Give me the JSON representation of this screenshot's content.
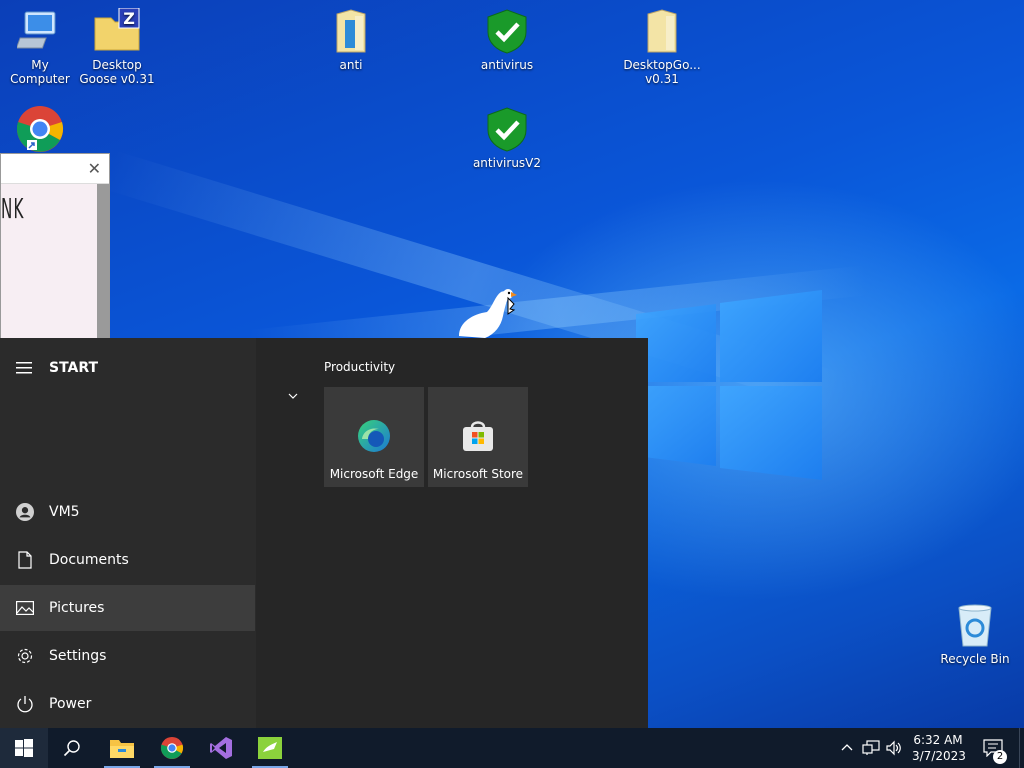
{
  "desktop": {
    "icons": [
      {
        "label": "My Computer",
        "icon": "computer-icon"
      },
      {
        "label": "Desktop Goose v0.31",
        "icon": "zip-archive-icon"
      },
      {
        "label": "anti",
        "icon": "folder-icon"
      },
      {
        "label": "antivirus",
        "icon": "shield-check-icon"
      },
      {
        "label": "DesktopGo... v0.31",
        "icon": "folder-icon"
      },
      {
        "label": "antivirusV2",
        "icon": "shield-check-icon"
      },
      {
        "label": "",
        "icon": "chrome-shortcut-icon"
      },
      {
        "label": "Recycle Bin",
        "icon": "recycle-bin-icon"
      }
    ]
  },
  "side_window": {
    "close_glyph": "✕",
    "text": "NK"
  },
  "start_menu": {
    "header": "START",
    "left_items": [
      {
        "label": "VM5",
        "icon": "user-avatar-icon"
      },
      {
        "label": "Documents",
        "icon": "document-icon"
      },
      {
        "label": "Pictures",
        "icon": "pictures-icon"
      },
      {
        "label": "Settings",
        "icon": "gear-icon"
      },
      {
        "label": "Power",
        "icon": "power-icon"
      }
    ],
    "group_title": "Productivity",
    "tiles": [
      {
        "label": "Microsoft Edge",
        "icon": "edge-icon"
      },
      {
        "label": "Microsoft Store",
        "icon": "store-icon"
      }
    ]
  },
  "taskbar": {
    "buttons": [
      "windows-start-icon",
      "search-icon",
      "file-explorer-icon",
      "chrome-icon",
      "visual-studio-icon",
      "app-icon"
    ],
    "clock": {
      "time": "6:32 AM",
      "date": "3/7/2023"
    },
    "notification_count": "2"
  },
  "colors": {
    "wallpaper": "#0a56d8",
    "start_bg": "#262626",
    "taskbar_bg": "#101b2b",
    "shield_green": "#1a9a2a"
  }
}
